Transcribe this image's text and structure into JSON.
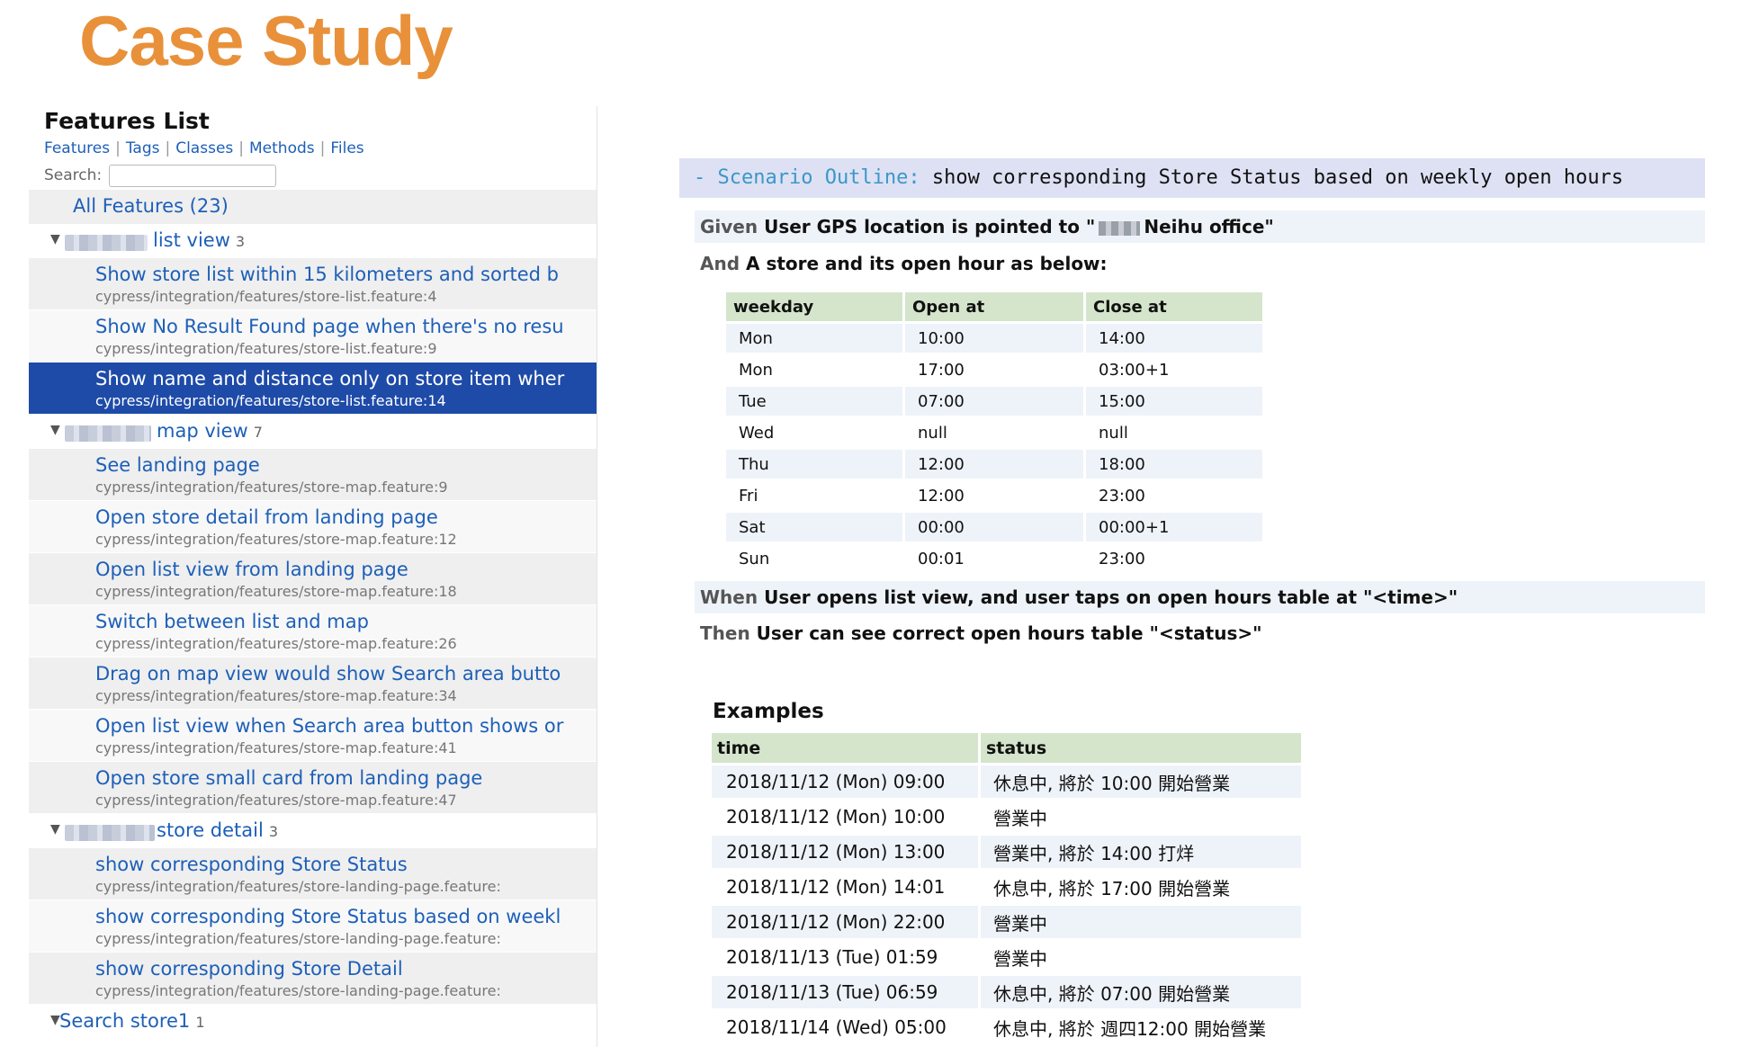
{
  "page_title": "Case Study",
  "features_list": {
    "title": "Features List",
    "nav_links": [
      "Features",
      "Tags",
      "Classes",
      "Methods",
      "Files"
    ],
    "search_label": "Search:",
    "search_value": "",
    "all_features": "All Features (23)",
    "groups": [
      {
        "label": "list view",
        "count": "3",
        "items": [
          {
            "title": "Show store list within 15 kilometers and sorted b",
            "path": "cypress/integration/features/store-list.feature:4",
            "selected": false
          },
          {
            "title": "Show No Result Found page when there's no resu",
            "path": "cypress/integration/features/store-list.feature:9",
            "selected": false
          },
          {
            "title": "Show name and distance only on store item wher",
            "path": "cypress/integration/features/store-list.feature:14",
            "selected": true
          }
        ]
      },
      {
        "label": "map view",
        "count": "7",
        "items": [
          {
            "title": "See landing page",
            "path": "cypress/integration/features/store-map.feature:9",
            "selected": false
          },
          {
            "title": "Open store detail from landing page",
            "path": "cypress/integration/features/store-map.feature:12",
            "selected": false
          },
          {
            "title": "Open list view from landing page",
            "path": "cypress/integration/features/store-map.feature:18",
            "selected": false
          },
          {
            "title": "Switch between list and map",
            "path": "cypress/integration/features/store-map.feature:26",
            "selected": false
          },
          {
            "title": "Drag on map view would show Search area butto",
            "path": "cypress/integration/features/store-map.feature:34",
            "selected": false
          },
          {
            "title": "Open list view when Search area button shows or",
            "path": "cypress/integration/features/store-map.feature:41",
            "selected": false
          },
          {
            "title": "Open store small card from landing page",
            "path": "cypress/integration/features/store-map.feature:47",
            "selected": false
          }
        ]
      },
      {
        "label": "store detail",
        "count": "3",
        "items": [
          {
            "title": "show corresponding Store Status",
            "path": "cypress/integration/features/store-landing-page.feature:",
            "selected": false
          },
          {
            "title": "show corresponding Store Status based on weekl",
            "path": "cypress/integration/features/store-landing-page.feature:",
            "selected": false
          },
          {
            "title": "show corresponding Store Detail",
            "path": "cypress/integration/features/store-landing-page.feature:",
            "selected": false
          }
        ]
      },
      {
        "label": "Search store1",
        "count": "1",
        "items": []
      }
    ]
  },
  "scenario": {
    "keyword": "- Scenario Outline:",
    "title": "show corresponding Store Status based on weekly open hours",
    "steps": {
      "given": {
        "keyword": "Given",
        "text_before": "User GPS location is pointed to \"",
        "text_after": "Neihu office\""
      },
      "and": {
        "keyword": "And",
        "text": "A store and its open hour as below:"
      },
      "when": {
        "keyword": "When",
        "text": "User opens list view, and user taps on open hours table at \"<time>\""
      },
      "then": {
        "keyword": "Then",
        "text": "User can see correct open hours table \"<status>\""
      }
    },
    "hours_table": {
      "headers": [
        "weekday",
        "Open at",
        "Close at"
      ],
      "rows": [
        [
          "Mon",
          "10:00",
          "14:00"
        ],
        [
          "Mon",
          "17:00",
          "03:00+1"
        ],
        [
          "Tue",
          "07:00",
          "15:00"
        ],
        [
          "Wed",
          "null",
          "null"
        ],
        [
          "Thu",
          "12:00",
          "18:00"
        ],
        [
          "Fri",
          "12:00",
          "23:00"
        ],
        [
          "Sat",
          "00:00",
          "00:00+1"
        ],
        [
          "Sun",
          "00:01",
          "23:00"
        ]
      ]
    },
    "examples": {
      "title": "Examples",
      "headers": [
        "time",
        "status"
      ],
      "rows": [
        [
          "2018/11/12 (Mon) 09:00",
          "休息中, 將於 10:00 開始營業"
        ],
        [
          "2018/11/12 (Mon) 10:00",
          "營業中"
        ],
        [
          "2018/11/12 (Mon) 13:00",
          "營業中, 將於 14:00 打烊"
        ],
        [
          "2018/11/12 (Mon) 14:01",
          "休息中, 將於 17:00 開始營業"
        ],
        [
          "2018/11/12 (Mon) 22:00",
          "營業中"
        ],
        [
          "2018/11/13 (Tue) 01:59",
          "營業中"
        ],
        [
          "2018/11/13 (Tue) 06:59",
          "休息中, 將於 07:00 開始營業"
        ],
        [
          "2018/11/14 (Wed) 05:00",
          "休息中, 將於 週四12:00 開始營業"
        ]
      ]
    }
  }
}
